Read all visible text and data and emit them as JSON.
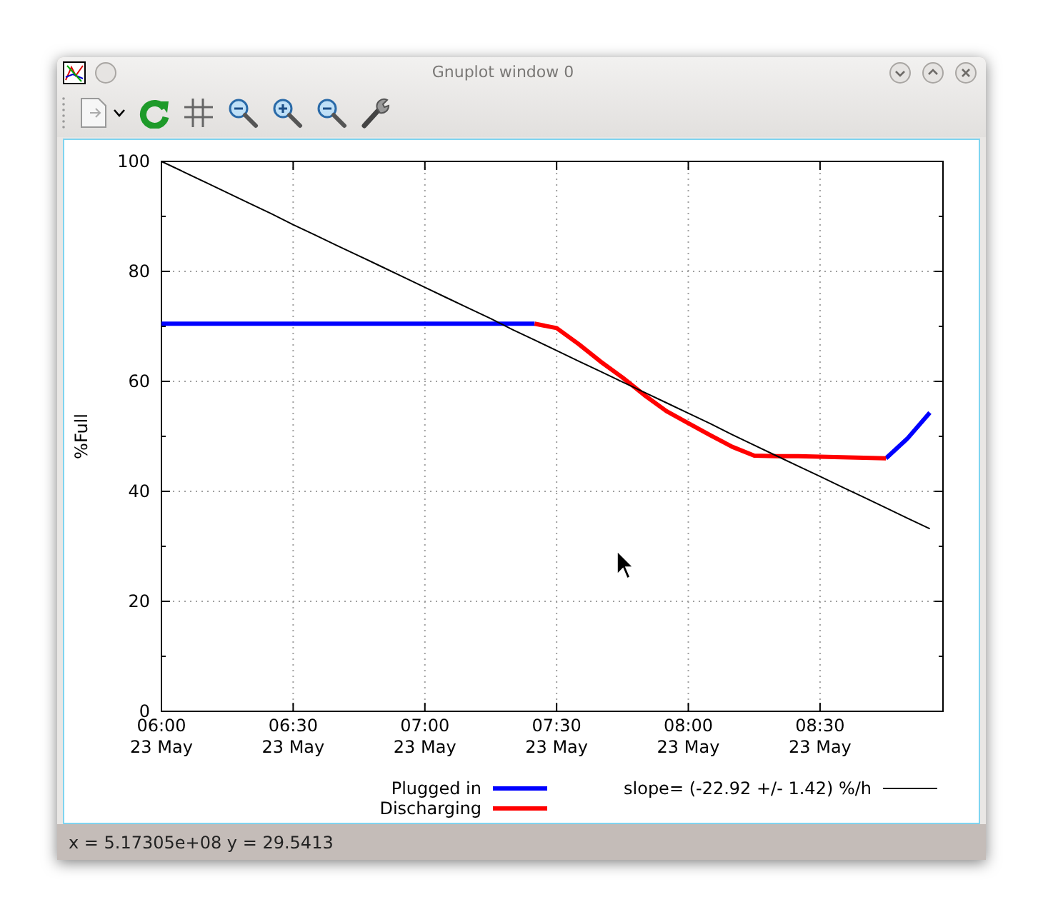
{
  "window": {
    "title": "Gnuplot window 0"
  },
  "plot": {
    "chart_data": {
      "type": "line",
      "ylabel": "%Full",
      "ylim": [
        0,
        100
      ],
      "grid": true,
      "legend": "bottom",
      "categories": [
        "06:00\n23 May",
        null,
        null,
        null,
        null,
        null,
        "06:30\n23 May",
        null,
        null,
        null,
        null,
        null,
        "07:00\n23 May",
        null,
        null,
        null,
        null,
        null,
        "07:30\n23 May",
        null,
        null,
        null,
        null,
        null,
        "08:00\n23 May",
        null,
        null,
        null,
        null,
        null,
        "08:30\n23 May",
        null,
        null,
        null,
        null,
        null
      ],
      "yticks": [
        0,
        20,
        40,
        60,
        80,
        100
      ],
      "series": [
        {
          "name": "Plugged in",
          "color": "#0000ff",
          "values": [
            70.5,
            70.5,
            70.5,
            70.5,
            70.5,
            70.5,
            70.5,
            70.5,
            70.5,
            70.5,
            70.5,
            70.5,
            70.5,
            70.5,
            70.5,
            70.5,
            70.5,
            70.5,
            null,
            null,
            null,
            null,
            null,
            null,
            null,
            null,
            null,
            null,
            null,
            null,
            null,
            null,
            null,
            46.0,
            49.7,
            54.3
          ]
        },
        {
          "name": "Discharging",
          "color": "#ff0000",
          "values": [
            null,
            null,
            null,
            null,
            null,
            null,
            null,
            null,
            null,
            null,
            null,
            null,
            null,
            null,
            null,
            null,
            null,
            70.5,
            69.7,
            66.8,
            63.6,
            60.7,
            57.5,
            54.6,
            52.4,
            50.2,
            48.1,
            46.5,
            46.4,
            46.4,
            46.3,
            46.2,
            46.1,
            46.0,
            null,
            null
          ]
        },
        {
          "name": "slope= (-22.92 +/- 1.42) %/h",
          "color": "#000000",
          "values": [
            100,
            98.1,
            96.2,
            94.3,
            92.4,
            90.5,
            88.5,
            86.6,
            84.7,
            82.8,
            80.9,
            79.0,
            77.1,
            75.2,
            73.3,
            71.4,
            69.4,
            67.5,
            65.6,
            63.7,
            61.8,
            59.9,
            58.0,
            56.1,
            54.2,
            52.3,
            50.3,
            48.4,
            46.5,
            44.6,
            42.7,
            40.8,
            38.9,
            37.0,
            35.1,
            33.2
          ]
        }
      ]
    }
  },
  "status_bar": "x = 5.17305e+08 y = 29.5413"
}
